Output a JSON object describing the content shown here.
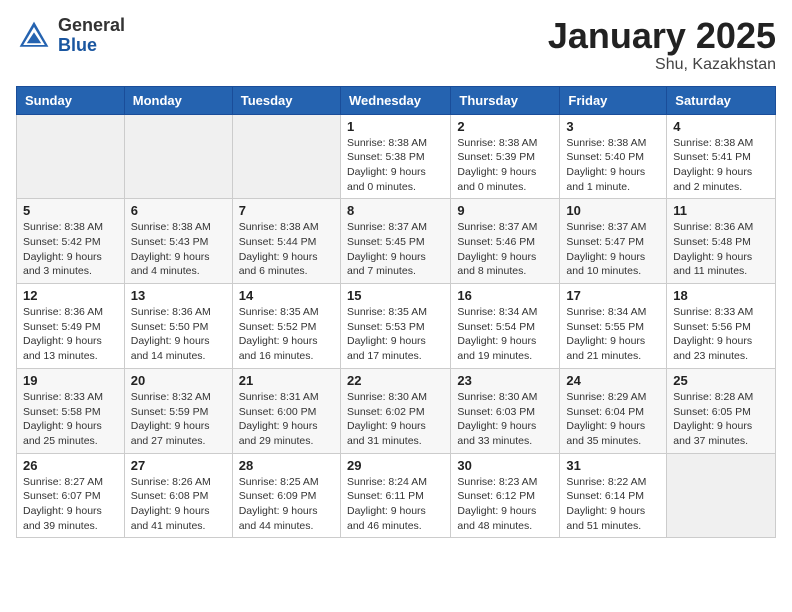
{
  "header": {
    "logo_general": "General",
    "logo_blue": "Blue",
    "month_title": "January 2025",
    "location": "Shu, Kazakhstan"
  },
  "weekdays": [
    "Sunday",
    "Monday",
    "Tuesday",
    "Wednesday",
    "Thursday",
    "Friday",
    "Saturday"
  ],
  "weeks": [
    [
      {
        "day": "",
        "info": ""
      },
      {
        "day": "",
        "info": ""
      },
      {
        "day": "",
        "info": ""
      },
      {
        "day": "1",
        "info": "Sunrise: 8:38 AM\nSunset: 5:38 PM\nDaylight: 9 hours\nand 0 minutes."
      },
      {
        "day": "2",
        "info": "Sunrise: 8:38 AM\nSunset: 5:39 PM\nDaylight: 9 hours\nand 0 minutes."
      },
      {
        "day": "3",
        "info": "Sunrise: 8:38 AM\nSunset: 5:40 PM\nDaylight: 9 hours\nand 1 minute."
      },
      {
        "day": "4",
        "info": "Sunrise: 8:38 AM\nSunset: 5:41 PM\nDaylight: 9 hours\nand 2 minutes."
      }
    ],
    [
      {
        "day": "5",
        "info": "Sunrise: 8:38 AM\nSunset: 5:42 PM\nDaylight: 9 hours\nand 3 minutes."
      },
      {
        "day": "6",
        "info": "Sunrise: 8:38 AM\nSunset: 5:43 PM\nDaylight: 9 hours\nand 4 minutes."
      },
      {
        "day": "7",
        "info": "Sunrise: 8:38 AM\nSunset: 5:44 PM\nDaylight: 9 hours\nand 6 minutes."
      },
      {
        "day": "8",
        "info": "Sunrise: 8:37 AM\nSunset: 5:45 PM\nDaylight: 9 hours\nand 7 minutes."
      },
      {
        "day": "9",
        "info": "Sunrise: 8:37 AM\nSunset: 5:46 PM\nDaylight: 9 hours\nand 8 minutes."
      },
      {
        "day": "10",
        "info": "Sunrise: 8:37 AM\nSunset: 5:47 PM\nDaylight: 9 hours\nand 10 minutes."
      },
      {
        "day": "11",
        "info": "Sunrise: 8:36 AM\nSunset: 5:48 PM\nDaylight: 9 hours\nand 11 minutes."
      }
    ],
    [
      {
        "day": "12",
        "info": "Sunrise: 8:36 AM\nSunset: 5:49 PM\nDaylight: 9 hours\nand 13 minutes."
      },
      {
        "day": "13",
        "info": "Sunrise: 8:36 AM\nSunset: 5:50 PM\nDaylight: 9 hours\nand 14 minutes."
      },
      {
        "day": "14",
        "info": "Sunrise: 8:35 AM\nSunset: 5:52 PM\nDaylight: 9 hours\nand 16 minutes."
      },
      {
        "day": "15",
        "info": "Sunrise: 8:35 AM\nSunset: 5:53 PM\nDaylight: 9 hours\nand 17 minutes."
      },
      {
        "day": "16",
        "info": "Sunrise: 8:34 AM\nSunset: 5:54 PM\nDaylight: 9 hours\nand 19 minutes."
      },
      {
        "day": "17",
        "info": "Sunrise: 8:34 AM\nSunset: 5:55 PM\nDaylight: 9 hours\nand 21 minutes."
      },
      {
        "day": "18",
        "info": "Sunrise: 8:33 AM\nSunset: 5:56 PM\nDaylight: 9 hours\nand 23 minutes."
      }
    ],
    [
      {
        "day": "19",
        "info": "Sunrise: 8:33 AM\nSunset: 5:58 PM\nDaylight: 9 hours\nand 25 minutes."
      },
      {
        "day": "20",
        "info": "Sunrise: 8:32 AM\nSunset: 5:59 PM\nDaylight: 9 hours\nand 27 minutes."
      },
      {
        "day": "21",
        "info": "Sunrise: 8:31 AM\nSunset: 6:00 PM\nDaylight: 9 hours\nand 29 minutes."
      },
      {
        "day": "22",
        "info": "Sunrise: 8:30 AM\nSunset: 6:02 PM\nDaylight: 9 hours\nand 31 minutes."
      },
      {
        "day": "23",
        "info": "Sunrise: 8:30 AM\nSunset: 6:03 PM\nDaylight: 9 hours\nand 33 minutes."
      },
      {
        "day": "24",
        "info": "Sunrise: 8:29 AM\nSunset: 6:04 PM\nDaylight: 9 hours\nand 35 minutes."
      },
      {
        "day": "25",
        "info": "Sunrise: 8:28 AM\nSunset: 6:05 PM\nDaylight: 9 hours\nand 37 minutes."
      }
    ],
    [
      {
        "day": "26",
        "info": "Sunrise: 8:27 AM\nSunset: 6:07 PM\nDaylight: 9 hours\nand 39 minutes."
      },
      {
        "day": "27",
        "info": "Sunrise: 8:26 AM\nSunset: 6:08 PM\nDaylight: 9 hours\nand 41 minutes."
      },
      {
        "day": "28",
        "info": "Sunrise: 8:25 AM\nSunset: 6:09 PM\nDaylight: 9 hours\nand 44 minutes."
      },
      {
        "day": "29",
        "info": "Sunrise: 8:24 AM\nSunset: 6:11 PM\nDaylight: 9 hours\nand 46 minutes."
      },
      {
        "day": "30",
        "info": "Sunrise: 8:23 AM\nSunset: 6:12 PM\nDaylight: 9 hours\nand 48 minutes."
      },
      {
        "day": "31",
        "info": "Sunrise: 8:22 AM\nSunset: 6:14 PM\nDaylight: 9 hours\nand 51 minutes."
      },
      {
        "day": "",
        "info": ""
      }
    ]
  ]
}
